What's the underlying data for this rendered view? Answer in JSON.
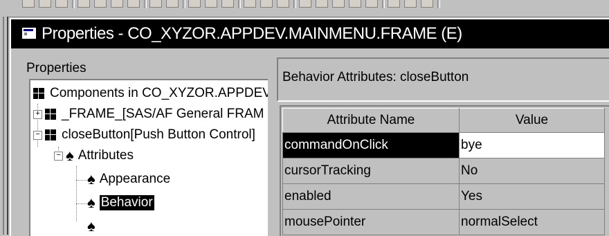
{
  "window": {
    "title": "Properties - CO_XYZOR.APPDEV.MAINMENU.FRAME (E)"
  },
  "left_panel": {
    "label": "Properties",
    "tree": [
      {
        "label": "Components in CO_XYZOR.APPDEV",
        "icon": "component-icon",
        "expander": ""
      },
      {
        "label": "_FRAME_[SAS/AF General FRAM",
        "icon": "component-icon",
        "expander": "+"
      },
      {
        "label": "closeButton[Push Button Control]",
        "icon": "component-icon",
        "expander": "−"
      },
      {
        "label": "Attributes",
        "icon": "attribute-icon",
        "expander": "−"
      },
      {
        "label": "Appearance",
        "icon": "attribute-icon",
        "expander": ""
      },
      {
        "label": "Behavior",
        "icon": "attribute-icon",
        "expander": "",
        "selected": true
      }
    ]
  },
  "right_panel": {
    "header": "Behavior Attributes: closeButton",
    "columns": [
      "Attribute Name",
      "Value"
    ],
    "rows": [
      {
        "name": "commandOnClick",
        "value": "bye",
        "selected": true
      },
      {
        "name": "cursorTracking",
        "value": "No"
      },
      {
        "name": "enabled",
        "value": "Yes"
      },
      {
        "name": "mousePointer",
        "value": "normalSelect"
      }
    ]
  },
  "colors": {
    "titlebar": "#000000",
    "window_bg": "#c0c0c0",
    "selection": "#000000"
  }
}
